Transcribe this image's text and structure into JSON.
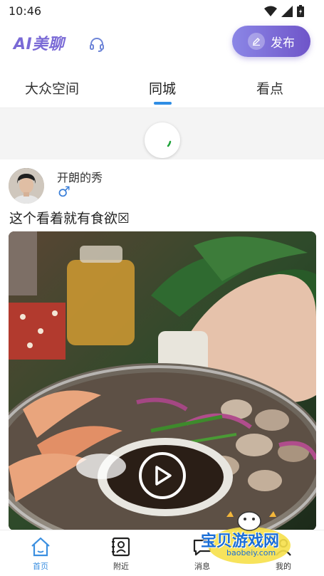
{
  "status_bar": {
    "time": "10:46"
  },
  "header": {
    "logo": "AI美聊",
    "publish_label": "发布"
  },
  "tabs": [
    {
      "label": "大众空间",
      "active": false
    },
    {
      "label": "同城",
      "active": true
    },
    {
      "label": "看点",
      "active": false
    }
  ],
  "post": {
    "username": "开朗的秀",
    "gender_symbol": "♂",
    "text": "这个看着就有食欲☒"
  },
  "watermark": {
    "text": "宝贝游戏网",
    "url": "baobeiy.com"
  },
  "bottom_nav": [
    {
      "label": "首页",
      "icon": "home-icon",
      "active": true
    },
    {
      "label": "附近",
      "icon": "contacts-icon",
      "active": false
    },
    {
      "label": "消息",
      "icon": "message-icon",
      "active": false
    },
    {
      "label": "我的",
      "icon": "profile-icon",
      "active": false
    }
  ],
  "colors": {
    "accent": "#7a6ad6",
    "tab_indicator": "#2f8de4",
    "nav_active": "#3b8fe0"
  }
}
